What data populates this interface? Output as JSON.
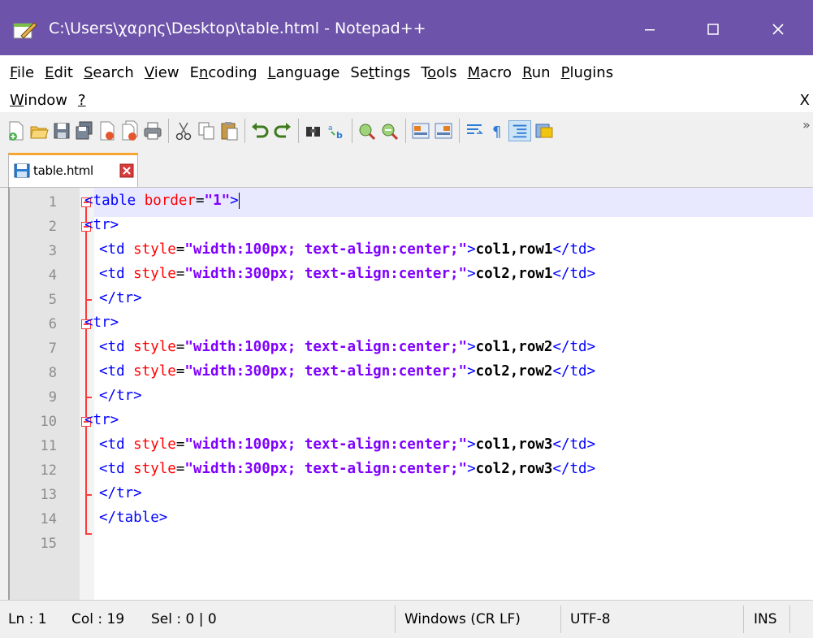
{
  "window": {
    "title": "C:\\Users\\χαρης\\Desktop\\table.html - Notepad++",
    "titlebar_color": "#6d54aa",
    "controls": {
      "minimize": "minimize-icon",
      "maximize": "maximize-icon",
      "close": "close-icon"
    }
  },
  "menu": {
    "row1": [
      "File",
      "Edit",
      "Search",
      "View",
      "Encoding",
      "Language",
      "Settings",
      "Tools",
      "Macro",
      "Run",
      "Plugins"
    ],
    "row2": [
      "Window",
      "?"
    ],
    "close_label": "X"
  },
  "toolbar": {
    "icons": [
      "new-file-icon",
      "open-file-icon",
      "save-icon",
      "save-all-icon",
      "close-icon",
      "close-all-icon",
      "print-icon",
      "cut-icon",
      "copy-icon",
      "paste-icon",
      "undo-icon",
      "redo-icon",
      "find-icon",
      "replace-icon",
      "zoom-in-icon",
      "zoom-out-icon",
      "sync-vertical-icon",
      "sync-horizontal-icon",
      "word-wrap-icon",
      "show-all-chars-icon",
      "indent-guide-icon",
      "user-lang-icon"
    ],
    "overflow": "»"
  },
  "tabs": [
    {
      "label": "table.html",
      "active": true
    }
  ],
  "editor": {
    "lines": [
      {
        "n": "1",
        "text": "<table border=\"1\">"
      },
      {
        "n": "2",
        "text": "<tr>"
      },
      {
        "n": "3",
        "text": "<td style=\"width:100px; text-align:center;\">col1,row1</td>"
      },
      {
        "n": "4",
        "text": "<td style=\"width:300px; text-align:center;\">col2,row1</td>"
      },
      {
        "n": "5",
        "text": "</tr>"
      },
      {
        "n": "6",
        "text": "<tr>"
      },
      {
        "n": "7",
        "text": "<td style=\"width:100px; text-align:center;\">col1,row2</td>"
      },
      {
        "n": "8",
        "text": "<td style=\"width:300px; text-align:center;\">col2,row2</td>"
      },
      {
        "n": "9",
        "text": "</tr>"
      },
      {
        "n": "10",
        "text": "<tr>"
      },
      {
        "n": "11",
        "text": "<td style=\"width:100px; text-align:center;\">col1,row3</td>"
      },
      {
        "n": "12",
        "text": "<td style=\"width:300px; text-align:center;\">col2,row3</td>"
      },
      {
        "n": "13",
        "text": "</tr>"
      },
      {
        "n": "14",
        "text": "</table>"
      },
      {
        "n": "15",
        "text": ""
      }
    ],
    "colors": {
      "tag": "#0000ff",
      "attribute": "#ff0000",
      "string": "#8000ff",
      "text": "#000000",
      "current_line": "#e8e8ff"
    }
  },
  "status": {
    "ln": "Ln : 1",
    "col": "Col : 19",
    "sel": "Sel : 0 | 0",
    "eol": "Windows (CR LF)",
    "encoding": "UTF-8",
    "mode": "INS"
  }
}
